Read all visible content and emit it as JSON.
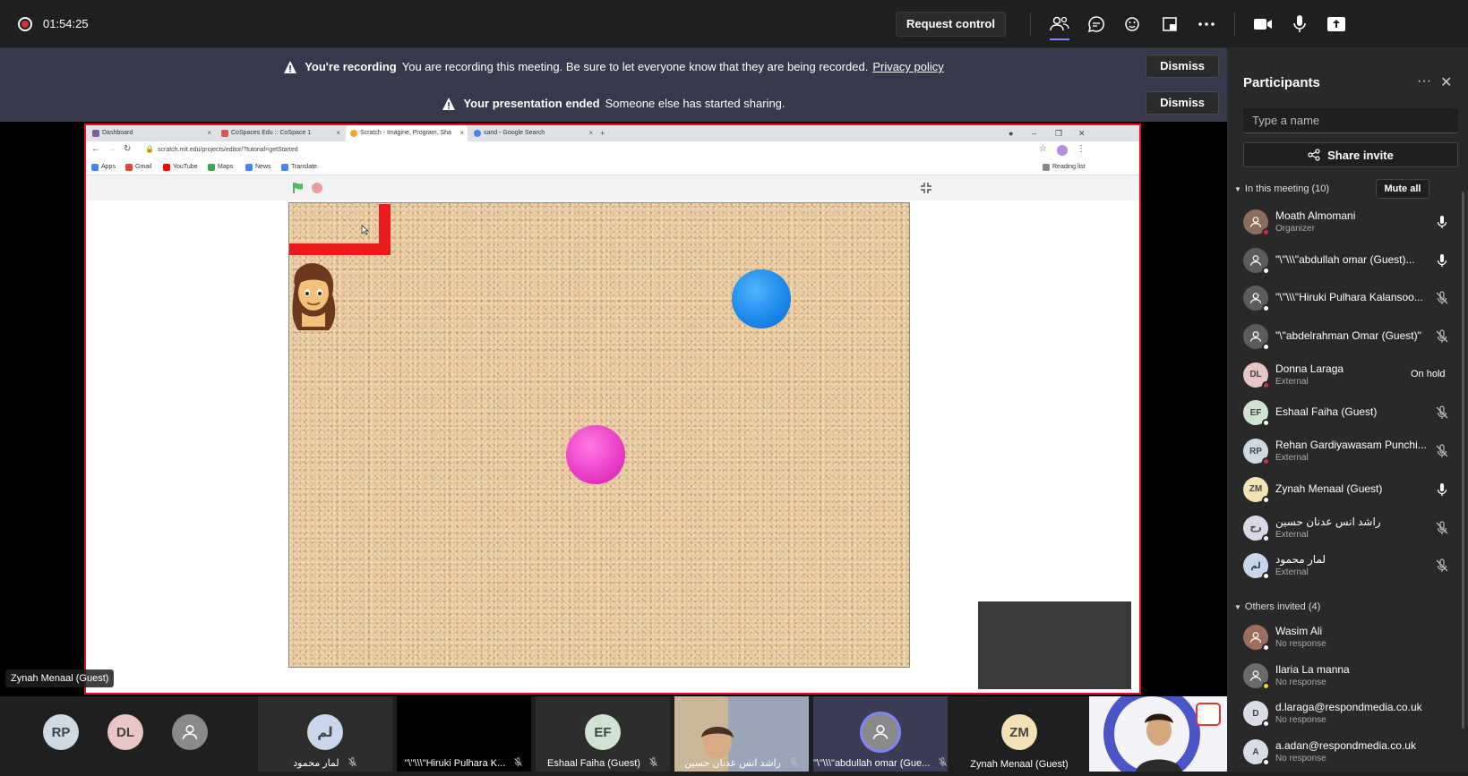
{
  "toolbar": {
    "timer": "01:54:25",
    "request_control_label": "Request control",
    "icons": [
      "participants-icon",
      "chat-icon",
      "reactions-icon",
      "share-tray-icon",
      "more-icon",
      "camera-icon",
      "mic-icon",
      "share-icon"
    ]
  },
  "banners": [
    {
      "title": "You're recording",
      "text": "You are recording this meeting. Be sure to let everyone know that they are being recorded.",
      "link": "Privacy policy",
      "dismiss": "Dismiss"
    },
    {
      "title": "Your presentation ended",
      "text": "Someone else has started sharing.",
      "dismiss": "Dismiss"
    }
  ],
  "browser": {
    "tabs": [
      "Dashboard",
      "CoSpaces Edu :: CoSpace 1",
      "Scratch - Imagine, Program, Sha",
      "sand - Google Search"
    ],
    "url": "scratch.mit.edu/projects/editor/?tutorial=getStarted",
    "bookmarks": [
      "Apps",
      "Gmail",
      "YouTube",
      "Maps",
      "News",
      "Translate"
    ],
    "reading_list": "Reading list"
  },
  "presenter_tag": "Zynah Menaal (Guest)",
  "panel": {
    "title": "Participants",
    "search_placeholder": "Type a name",
    "share_invite": "Share invite",
    "in_meeting_label": "In this meeting (10)",
    "mute_all": "Mute all",
    "others_label": "Others invited (4)",
    "participants": [
      {
        "initials": "",
        "name": "Moath Almomani",
        "sub": "Organizer",
        "mic": "on",
        "avatar_color": "#8a6d5a",
        "status": "#c4314b"
      },
      {
        "initials": "",
        "name": "\"\\\"\\\\\\\"abdullah omar (Guest)...",
        "sub": "",
        "mic": "on",
        "avatar_color": "#5c5c5c",
        "status": "#ffffff"
      },
      {
        "initials": "",
        "name": "\"\\\"\\\\\\\"Hiruki Pulhara Kalansoo...",
        "sub": "",
        "mic": "off",
        "avatar_color": "#5c5c5c",
        "status": "#ffffff"
      },
      {
        "initials": "",
        "name": "\"\\\"abdelrahman Omar (Guest)\"",
        "sub": "",
        "mic": "off",
        "avatar_color": "#5c5c5c",
        "status": "#ffffff"
      },
      {
        "initials": "DL",
        "name": "Donna Laraga",
        "sub": "External",
        "mic": "hold",
        "hold_label": "On hold",
        "avatar_color": "#e8c6c6",
        "status": "#c4314b"
      },
      {
        "initials": "EF",
        "name": "Eshaal Faiha (Guest)",
        "sub": "",
        "mic": "off",
        "avatar_color": "#cfe3d2",
        "status": "#ffffff"
      },
      {
        "initials": "RP",
        "name": "Rehan Gardiyawasam Punchi...",
        "sub": "External",
        "mic": "off",
        "avatar_color": "#cdd9e3",
        "status": "#c4314b"
      },
      {
        "initials": "ZM",
        "name": "Zynah Menaal (Guest)",
        "sub": "",
        "mic": "on",
        "avatar_color": "#f3e2b3",
        "status": "#ffffff"
      },
      {
        "initials": "رح",
        "name": "راشد انس عدنان حسين",
        "sub": "External",
        "mic": "off",
        "avatar_color": "#d8d8e8",
        "status": "#ffffff"
      },
      {
        "initials": "لم",
        "name": "لمار محمود",
        "sub": "External",
        "mic": "off",
        "avatar_color": "#c9d6ec",
        "status": "#ffffff"
      }
    ],
    "others": [
      {
        "initials": "",
        "name": "Wasim Ali",
        "sub": "No response",
        "avatar_color": "#9b6f5e",
        "status": "#ffffff"
      },
      {
        "initials": "",
        "name": "Ilaria La manna",
        "sub": "No response",
        "avatar_color": "#6b6b6b",
        "status": "#f8d22a"
      },
      {
        "initials": "D",
        "name": "d.laraga@respondmedia.co.uk",
        "sub": "No response",
        "avatar_color": "#d8dde8",
        "status": "#ffffff"
      },
      {
        "initials": "A",
        "name": "a.adan@respondmedia.co.uk",
        "sub": "No response",
        "avatar_color": "#d8dde8",
        "status": "#ffffff"
      }
    ]
  },
  "strip": [
    {
      "initials": "RP",
      "name": "",
      "bg": "#1f1f1f",
      "av": "#cdd9e3"
    },
    {
      "initials": "DL",
      "name": "",
      "bg": "#1f1f1f",
      "av": "#e8c6c6"
    },
    {
      "initials": "",
      "name": "",
      "bg": "#1f1f1f",
      "av": "#8a8a8a"
    },
    {
      "initials": "لم",
      "name": "لمار محمود",
      "bg": "#2d2d2d",
      "av": "#c9d6ec"
    },
    {
      "initials": "",
      "name": "\"\\\"\\\\\\\"Hiruki Pulhara K...",
      "bg": "#000000",
      "av": ""
    },
    {
      "initials": "EF",
      "name": "Eshaal Faiha (Guest)",
      "bg": "#2d2d2d",
      "av": "#cfe3d2"
    },
    {
      "initials": "",
      "name": "راشد انس عدنان حسين",
      "bg": "#8a7a60",
      "av": ""
    },
    {
      "initials": "",
      "name": "\"\\\"\\\\\\\"abdullah omar (Gue...",
      "bg": "#3a3d55",
      "av": "#8a8a8a"
    },
    {
      "initials": "ZM",
      "name": "Zynah Menaal (Guest)",
      "bg": "#1f1f1f",
      "av": "#f3e2b3"
    },
    {
      "initials": "",
      "name": "",
      "bg": "#ffffff",
      "av": ""
    }
  ]
}
